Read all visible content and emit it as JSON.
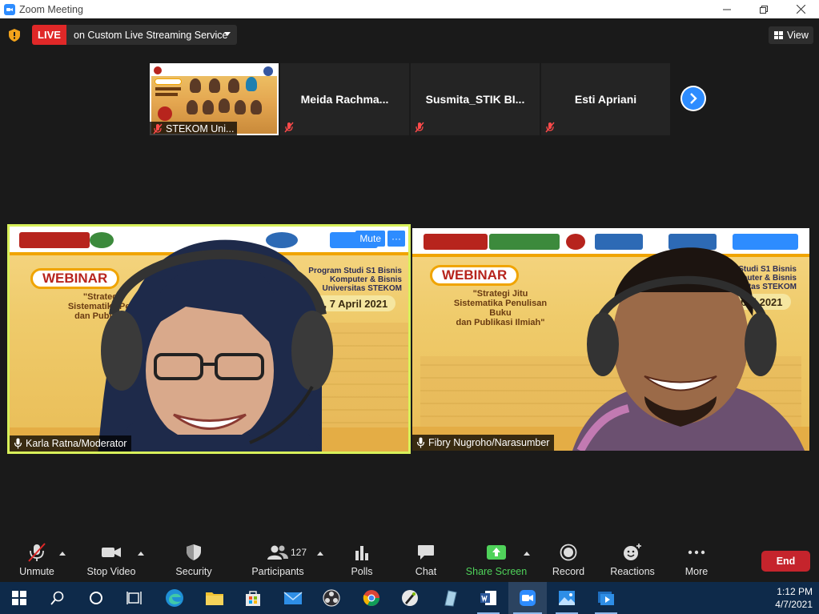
{
  "window": {
    "title": "Zoom Meeting"
  },
  "live": {
    "badge": "LIVE",
    "service_label": "on Custom Live Streaming Service"
  },
  "view_button": {
    "label": "View"
  },
  "thumbnails": [
    {
      "name": "STEKOM Uni...",
      "has_video": true
    },
    {
      "name": "Meida  Rachma...",
      "has_video": false
    },
    {
      "name": "Susmita_STIK  BI...",
      "has_video": false
    },
    {
      "name": "Esti Apriani",
      "has_video": false
    }
  ],
  "tiles": [
    {
      "name": "Karla Ratna/Moderator",
      "active": true,
      "mute_button": "Mute",
      "more_button": "···"
    },
    {
      "name": "Fibry Nugroho/Narasumber",
      "active": false
    }
  ],
  "toolbar": {
    "unmute": "Unmute",
    "stop_video": "Stop Video",
    "security": "Security",
    "participants": "Participants",
    "participant_count": "127",
    "polls": "Polls",
    "chat": "Chat",
    "share_screen": "Share Screen",
    "record": "Record",
    "reactions": "Reactions",
    "more": "More",
    "end": "End"
  },
  "taskbar": {
    "time": "1:12 PM",
    "date": "4/7/2021"
  },
  "colors": {
    "live_red": "#e02828",
    "zoom_blue": "#2d8cff",
    "share_green": "#4fd25a",
    "end_red": "#c5242c",
    "active_speaker_border": "#d8f05a"
  }
}
